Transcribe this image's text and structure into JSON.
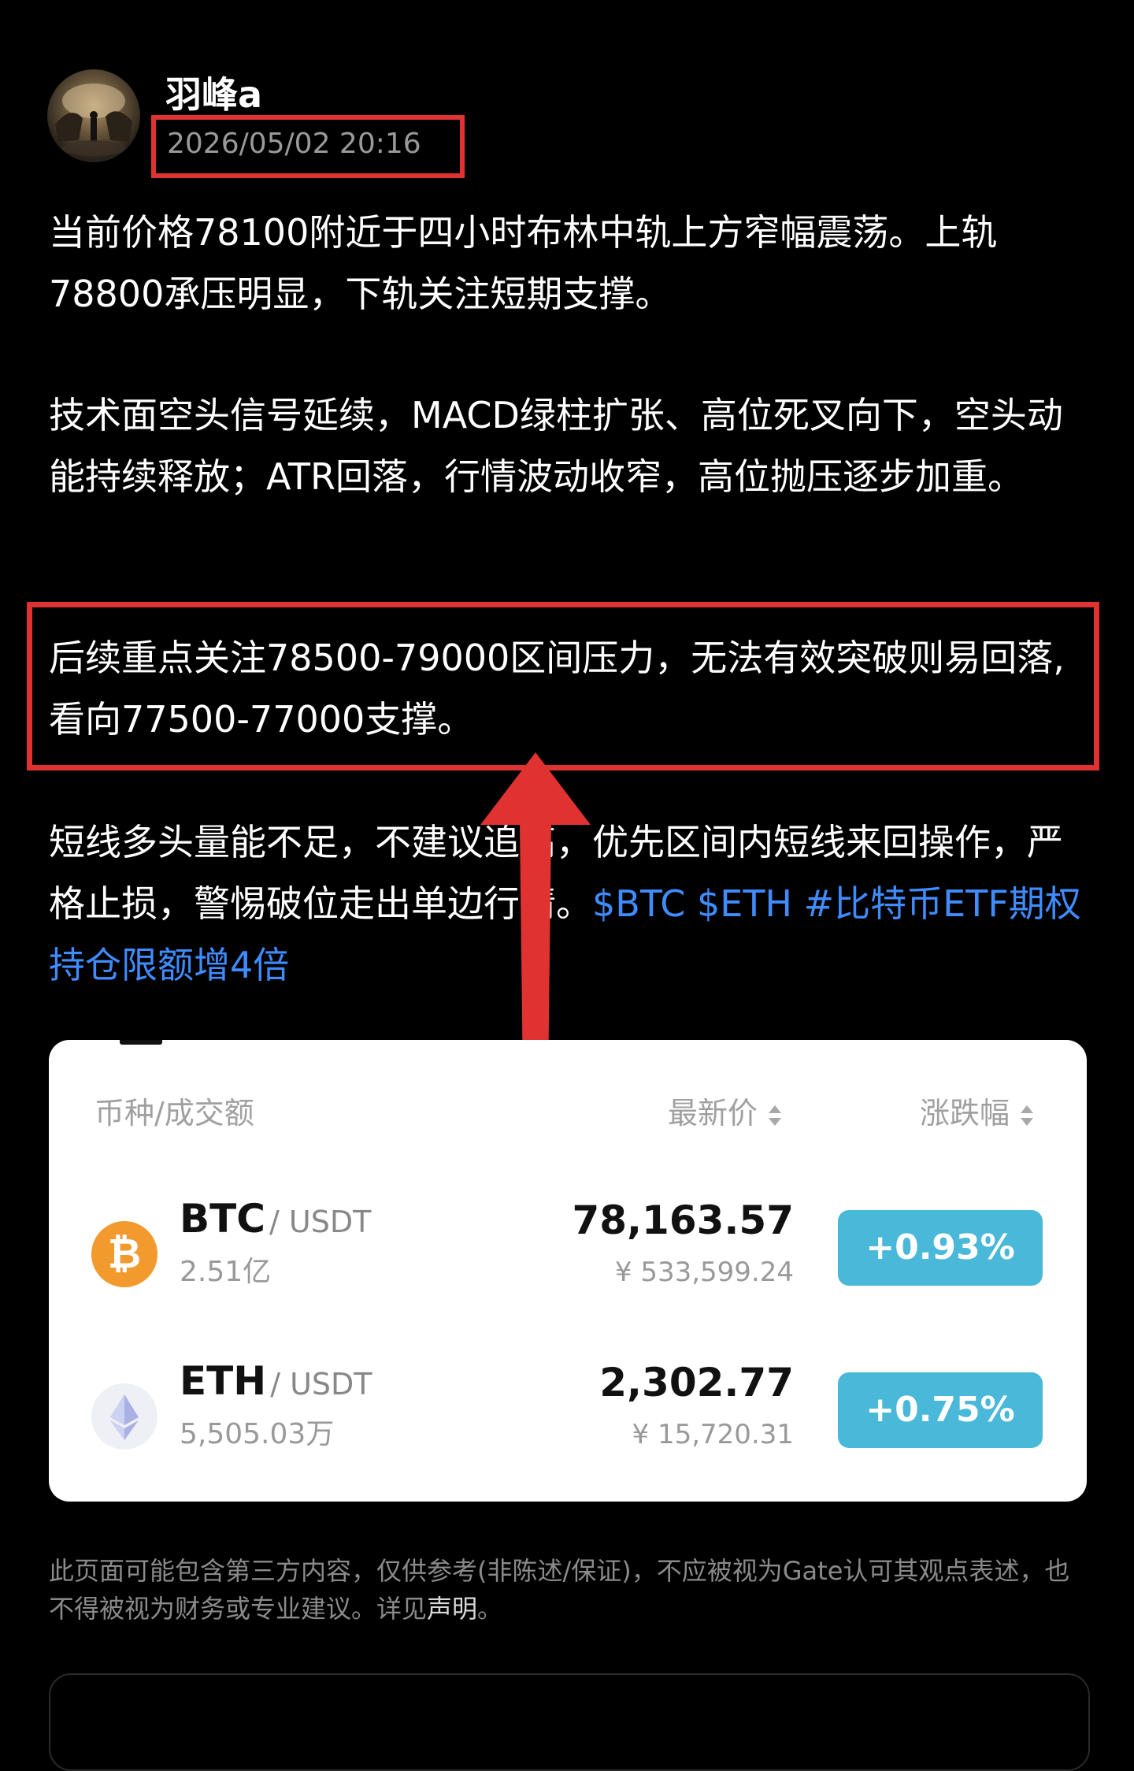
{
  "author": {
    "name": "羽峰a",
    "timestamp": "2026/05/02 20:16"
  },
  "post": {
    "p1": "当前价格78100附近于四小时布林中轨上方窄幅震荡。上轨78800承压明显，下轨关注短期支撑。",
    "p2": "技术面空头信号延续，MACD绿柱扩张、高位死叉向下，空头动能持续释放；ATR回落，行情波动收窄，高位抛压逐步加重。",
    "p3": "后续重点关注78500-79000区间压力，无法有效突破则易回落,看向77500-77000支撑。",
    "p4": "短线多头量能不足，不建议追高，优先区间内短线来回操作，严格止损，警惕破位走出单边行情。",
    "tag_btc": "$BTC",
    "tag_eth": "$ETH",
    "tag_topic": "#比特币ETF期权持仓限额增4倍"
  },
  "market": {
    "header_pair": "币种/成交额",
    "header_price": "最新价",
    "header_change": "涨跌幅",
    "rows": [
      {
        "base": "BTC",
        "quote": "/ USDT",
        "volume": "2.51亿",
        "price": "78,163.57",
        "price_cny": "¥ 533,599.24",
        "change": "+0.93%",
        "icon": "bitcoin-icon",
        "icon_glyph": "₿"
      },
      {
        "base": "ETH",
        "quote": "/ USDT",
        "volume": "5,505.03万",
        "price": "2,302.77",
        "price_cny": "¥ 15,720.31",
        "change": "+0.75%",
        "icon": "ethereum-icon"
      }
    ]
  },
  "disclaimer": {
    "text": "此页面可能包含第三方内容，仅供参考(非陈述/保证)，不应被视为Gate认可其观点表述，也不得被视为财务或专业建议。详见",
    "link": "声明",
    "end": "。"
  },
  "colors": {
    "background": "#000000",
    "annotation_red": "#e13232",
    "tag_blue": "#3f8cff",
    "change_badge": "#4ab8d8",
    "btc_orange": "#f29a2e"
  }
}
